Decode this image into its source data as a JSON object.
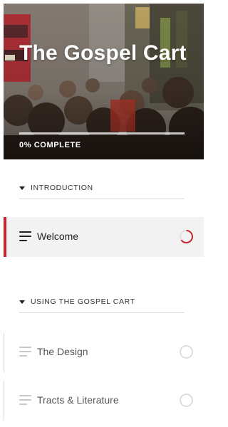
{
  "course": {
    "title": "The Gospel Cart",
    "progress_text": "0% COMPLETE",
    "progress_fraction": 0
  },
  "sections": [
    {
      "label": "INTRODUCTION",
      "lessons": [
        {
          "title": "Welcome",
          "state": "in-progress",
          "icon": "list-lines-icon",
          "status_icon": "progress-ring-icon"
        }
      ]
    },
    {
      "label": "USING THE GOSPEL CART",
      "lessons": [
        {
          "title": "The Design",
          "state": "not-started",
          "icon": "list-lines-icon",
          "status_icon": "empty-circle-icon"
        },
        {
          "title": "Tracts & Literature",
          "state": "not-started",
          "icon": "list-lines-icon",
          "status_icon": "empty-circle-icon"
        }
      ]
    }
  ],
  "colors": {
    "accent": "#c9242f",
    "active_bg": "#f2f2f2",
    "divider": "#dcdcdc",
    "muted_icon": "#c8c8c8"
  }
}
